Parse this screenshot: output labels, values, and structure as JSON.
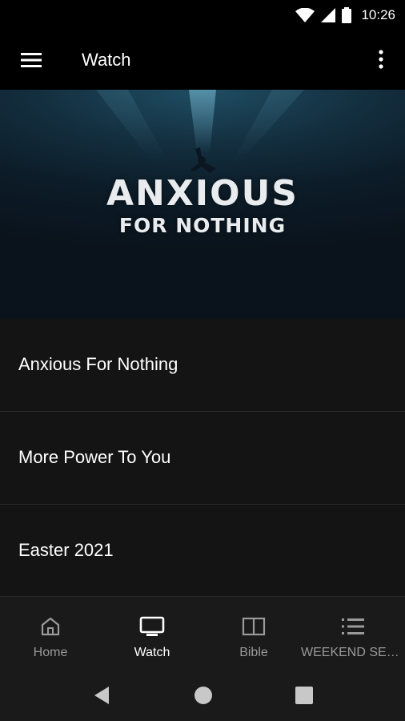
{
  "status_bar": {
    "time": "10:26",
    "icons": [
      "wifi-icon",
      "signal-icon",
      "battery-icon"
    ]
  },
  "app_bar": {
    "title": "Watch",
    "icons": [
      "menu-icon",
      "more-vert-icon"
    ]
  },
  "hero": {
    "title_line1": "ANXIOUS",
    "title_line2": "FOR NOTHING"
  },
  "series_list": [
    {
      "title": "Anxious For Nothing"
    },
    {
      "title": "More Power To You"
    },
    {
      "title": "Easter 2021"
    }
  ],
  "bottom_nav": {
    "active": "Watch",
    "items": [
      {
        "label": "Home",
        "icon": "home-icon"
      },
      {
        "label": "Watch",
        "icon": "tv-icon"
      },
      {
        "label": "Bible",
        "icon": "book-icon"
      },
      {
        "label": "WEEKEND SER…",
        "icon": "list-icon"
      }
    ]
  },
  "system_nav": {
    "icons": [
      "back-icon",
      "home-circle-icon",
      "recents-icon"
    ]
  },
  "colors": {
    "background": "#000000",
    "list_background": "#141414",
    "nav_background": "#1a1a1a",
    "active": "#ffffff",
    "inactive": "#9a9a9a"
  }
}
